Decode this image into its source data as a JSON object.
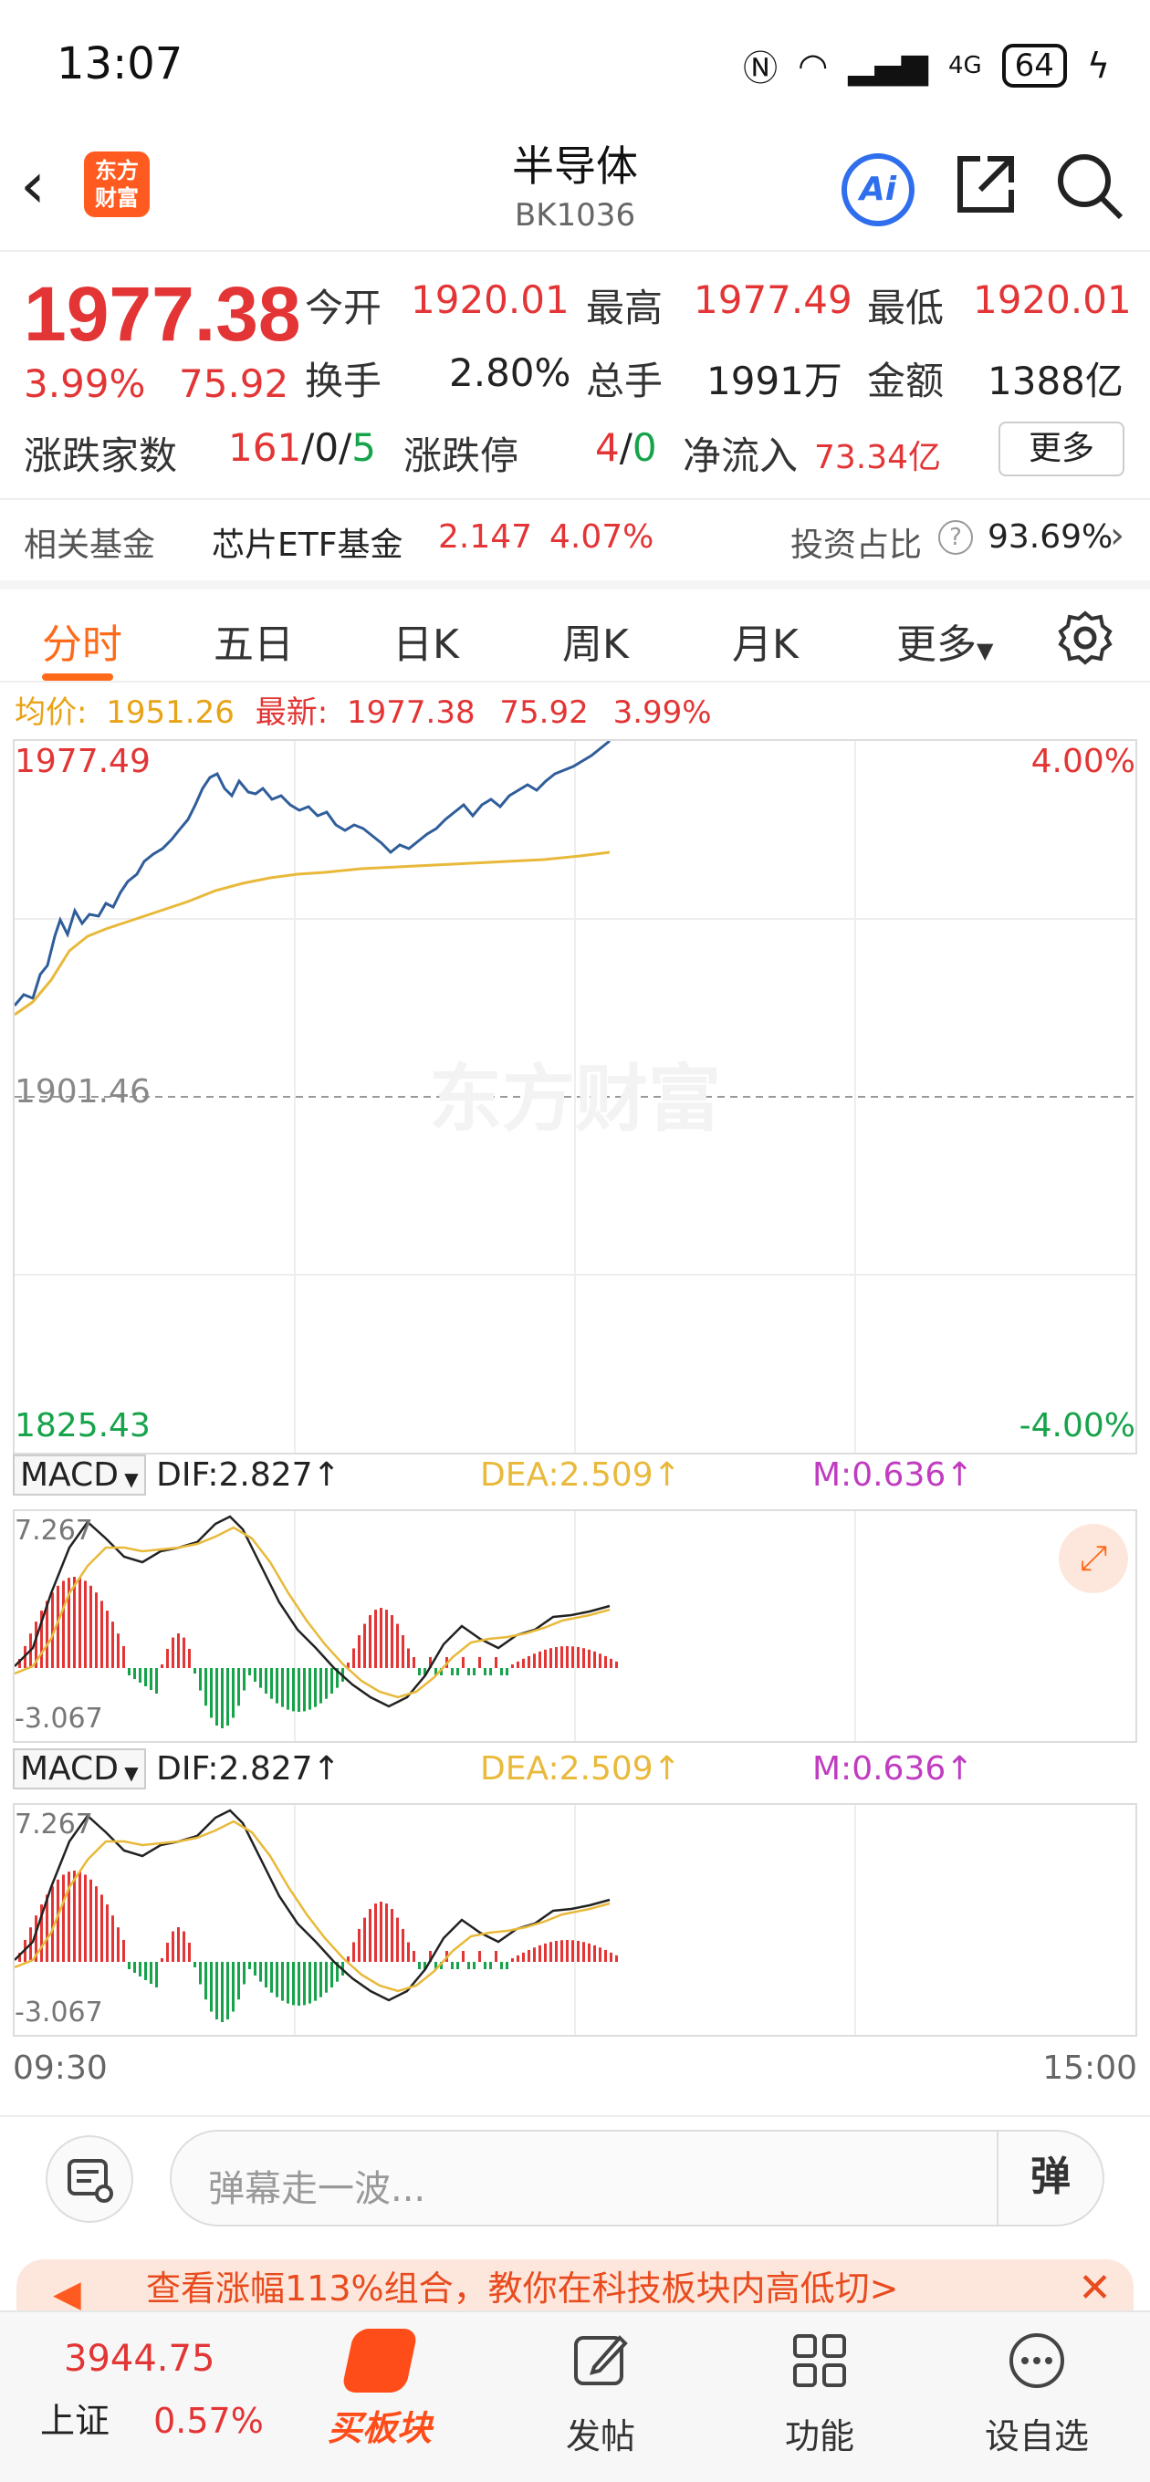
{
  "status_bar": {
    "time": "13:07",
    "battery": "64",
    "network": "4G"
  },
  "header": {
    "logo_line1": "东方",
    "logo_line2": "财富",
    "title": "半导体",
    "code": "BK1036",
    "ai_label": "Ai"
  },
  "quote": {
    "price": "1977.38",
    "change_pct": "3.99%",
    "change": "75.92",
    "open_label": "今开",
    "open": "1920.01",
    "high_label": "最高",
    "high": "1977.49",
    "low_label": "最低",
    "low": "1920.01",
    "turnover_label": "换手",
    "turnover": "2.80%",
    "volume_label": "总手",
    "volume": "1991万",
    "amount_label": "金额",
    "amount": "1388亿",
    "advdec_label": "涨跌家数",
    "adv": "161",
    "sep1": "/",
    "flat": "0",
    "sep2": "/",
    "dec": "5",
    "limit_label": "涨跌停",
    "limit_up": "4",
    "sep3": "/",
    "limit_down": "0",
    "netflow_label": "净流入",
    "netflow": "73.34亿",
    "more_btn": "更多"
  },
  "fund": {
    "label": "相关基金",
    "name": "芯片ETF基金",
    "price": "2.147",
    "pct": "4.07%",
    "ratio_label": "投资占比",
    "help": "?",
    "ratio": "93.69%",
    "arrow": "›"
  },
  "tabs": [
    "分时",
    "五日",
    "日K",
    "周K",
    "月K",
    "更多"
  ],
  "infobar": {
    "avg_label": "均价:",
    "avg": "1951.26",
    "latest_label": "最新:",
    "latest": "1977.38",
    "chg": "75.92",
    "pct": "3.99%"
  },
  "chart": {
    "top_price": "1977.49",
    "mid_price": "1901.46",
    "bottom_price": "1825.43",
    "top_pct": "4.00%",
    "bottom_pct": "-4.00%",
    "watermark": "东方财富"
  },
  "macd1": {
    "sel": "MACD",
    "dif": "DIF:2.827",
    "dea": "DEA:2.509",
    "m": "M:0.636",
    "top": "7.267",
    "bottom": "-3.067"
  },
  "macd2": {
    "sel": "MACD",
    "dif": "DIF:2.827",
    "dea": "DEA:2.509",
    "m": "M:0.636",
    "top": "7.267",
    "bottom": "-3.067"
  },
  "time_axis": {
    "start": "09:30",
    "end": "15:00"
  },
  "danmu": {
    "placeholder": "弹幕走一波...",
    "send": "弹"
  },
  "banner": {
    "text": "查看涨幅113%组合，教你在科技板块内高低切>"
  },
  "bottom_nav": {
    "index_value": "3944.75",
    "index_name": "上证",
    "index_pct": "0.57%",
    "items": [
      "买板块",
      "发帖",
      "功能",
      "设自选"
    ]
  },
  "colors": {
    "up": "#e33535",
    "down": "#16a34a",
    "accent": "#ff6a1a",
    "price_line": "#2f5d9a",
    "avg_line": "#e8b93a"
  }
}
